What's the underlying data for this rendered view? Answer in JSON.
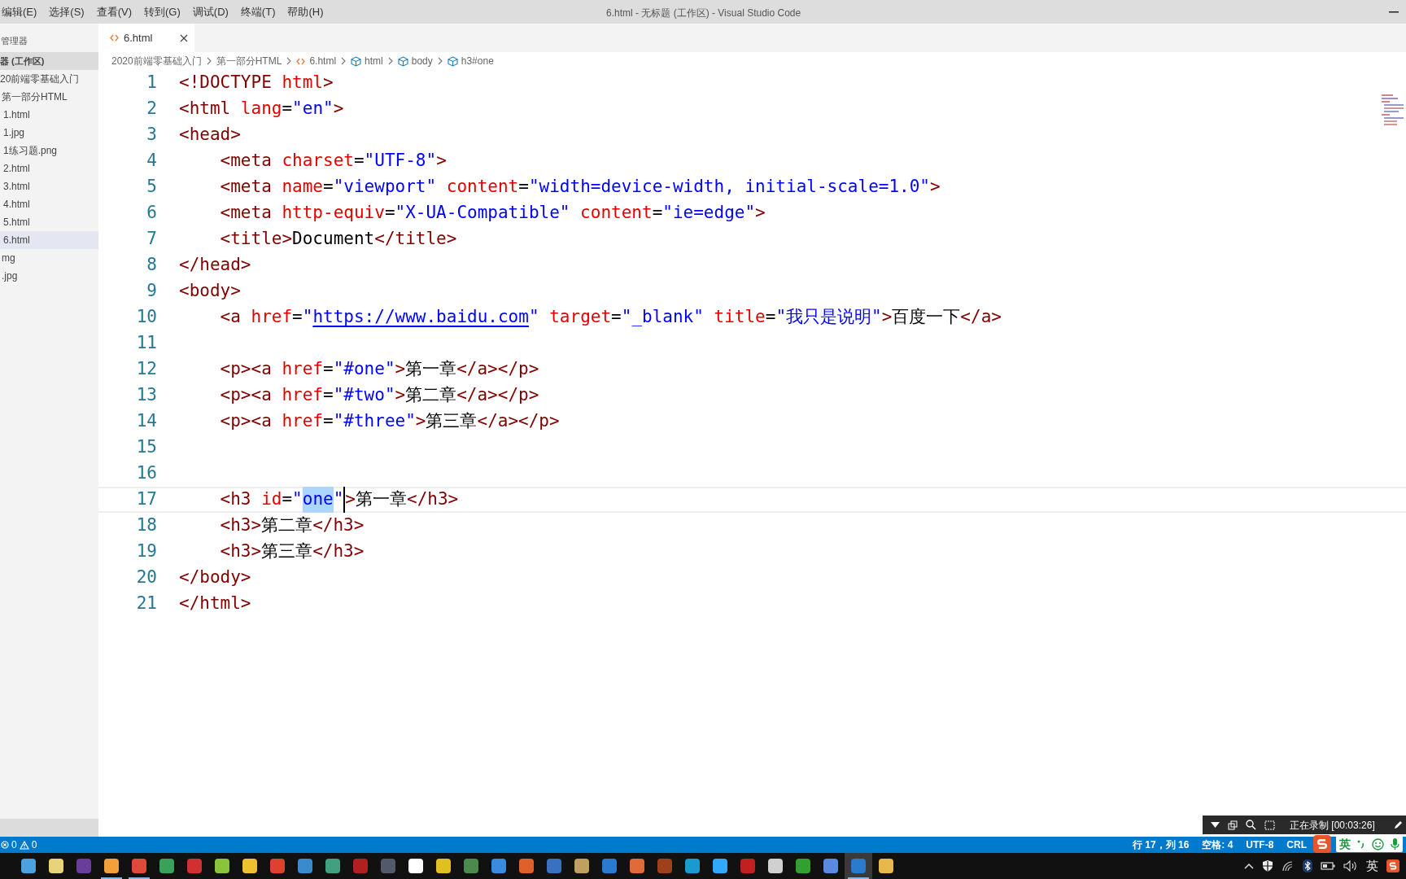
{
  "menu": [
    "编辑(E)",
    "选择(S)",
    "查看(V)",
    "转到(G)",
    "调试(D)",
    "终端(T)",
    "帮助(H)"
  ],
  "window": {
    "title": "6.html - 无标题 (工作区) - Visual Studio Code"
  },
  "sidebar": {
    "header": "管理器",
    "section": "器 (工作区)",
    "tree": [
      {
        "label": "20前端零基础入门",
        "selected": false,
        "children": [
          {
            "label": "第一部分HTML",
            "selected": false,
            "children": [
              {
                "label": "1.html",
                "selected": false
              },
              {
                "label": "1.jpg",
                "selected": false
              },
              {
                "label": "1练习题.png",
                "selected": false
              },
              {
                "label": "2.html",
                "selected": false
              },
              {
                "label": "3.html",
                "selected": false
              },
              {
                "label": "4.html",
                "selected": false
              },
              {
                "label": "5.html",
                "selected": false
              },
              {
                "label": "6.html",
                "selected": true
              }
            ]
          },
          {
            "label": "mg",
            "selected": false
          },
          {
            "label": ".jpg",
            "selected": false
          }
        ]
      }
    ]
  },
  "tabs": [
    {
      "label": "6.html",
      "selected": true
    }
  ],
  "breadcrumbs": [
    {
      "kind": "folder",
      "label": "2020前端零基础入门"
    },
    {
      "kind": "folder",
      "label": "第一部分HTML"
    },
    {
      "kind": "file",
      "label": "6.html"
    },
    {
      "kind": "element",
      "label": "html"
    },
    {
      "kind": "element",
      "label": "body"
    },
    {
      "kind": "element",
      "label": "h3#one"
    }
  ],
  "code": [
    {
      "number": "1",
      "current": false,
      "tokens": [
        {
          "kind": "tag",
          "text": "<!DOCTYPE"
        },
        {
          "kind": "attr",
          "text": " html"
        },
        {
          "kind": "tag",
          "text": ">"
        }
      ]
    },
    {
      "number": "2",
      "current": false,
      "tokens": [
        {
          "kind": "tag",
          "text": "<html"
        },
        {
          "kind": "attr",
          "text": " lang"
        },
        {
          "kind": "plain",
          "text": "="
        },
        {
          "kind": "str",
          "text": "\"en\""
        },
        {
          "kind": "tag",
          "text": ">"
        }
      ]
    },
    {
      "number": "3",
      "current": false,
      "tokens": [
        {
          "kind": "tag",
          "text": "<head>"
        }
      ]
    },
    {
      "number": "4",
      "current": false,
      "tokens": [
        {
          "kind": "tag",
          "text": "    <meta"
        },
        {
          "kind": "attr",
          "text": " charset"
        },
        {
          "kind": "plain",
          "text": "="
        },
        {
          "kind": "str",
          "text": "\"UTF-8\""
        },
        {
          "kind": "tag",
          "text": ">"
        }
      ]
    },
    {
      "number": "5",
      "current": false,
      "tokens": [
        {
          "kind": "tag",
          "text": "    <meta"
        },
        {
          "kind": "attr",
          "text": " name"
        },
        {
          "kind": "plain",
          "text": "="
        },
        {
          "kind": "str",
          "text": "\"viewport\""
        },
        {
          "kind": "attr",
          "text": " content"
        },
        {
          "kind": "plain",
          "text": "="
        },
        {
          "kind": "str",
          "text": "\"width=device-width, initial-scale=1.0\""
        },
        {
          "kind": "tag",
          "text": ">"
        }
      ]
    },
    {
      "number": "6",
      "current": false,
      "tokens": [
        {
          "kind": "tag",
          "text": "    <meta"
        },
        {
          "kind": "attr",
          "text": " http-equiv"
        },
        {
          "kind": "plain",
          "text": "="
        },
        {
          "kind": "str",
          "text": "\"X-UA-Compatible\""
        },
        {
          "kind": "attr",
          "text": " content"
        },
        {
          "kind": "plain",
          "text": "="
        },
        {
          "kind": "str",
          "text": "\"ie=edge\""
        },
        {
          "kind": "tag",
          "text": ">"
        }
      ]
    },
    {
      "number": "7",
      "current": false,
      "tokens": [
        {
          "kind": "tag",
          "text": "    <title>"
        },
        {
          "kind": "plain",
          "text": "Document"
        },
        {
          "kind": "tag",
          "text": "</title>"
        }
      ]
    },
    {
      "number": "8",
      "current": false,
      "tokens": [
        {
          "kind": "tag",
          "text": "</head>"
        }
      ]
    },
    {
      "number": "9",
      "current": false,
      "tokens": [
        {
          "kind": "tag",
          "text": "<body>"
        }
      ]
    },
    {
      "number": "10",
      "current": false,
      "tokens": [
        {
          "kind": "tag",
          "text": "    <a"
        },
        {
          "kind": "attr",
          "text": " href"
        },
        {
          "kind": "plain",
          "text": "="
        },
        {
          "kind": "str",
          "text": "\""
        },
        {
          "kind": "str",
          "text": "https://www.baidu.com",
          "link": true
        },
        {
          "kind": "str",
          "text": "\""
        },
        {
          "kind": "attr",
          "text": " target"
        },
        {
          "kind": "plain",
          "text": "="
        },
        {
          "kind": "str",
          "text": "\"_blank\""
        },
        {
          "kind": "attr",
          "text": " title"
        },
        {
          "kind": "plain",
          "text": "="
        },
        {
          "kind": "str",
          "text": "\"我只是说明\""
        },
        {
          "kind": "tag",
          "text": ">"
        },
        {
          "kind": "plain",
          "text": "百度一下"
        },
        {
          "kind": "tag",
          "text": "</a>"
        }
      ]
    },
    {
      "number": "11",
      "current": false
    },
    {
      "number": "12",
      "current": false,
      "tokens": [
        {
          "kind": "tag",
          "text": "    <p><a"
        },
        {
          "kind": "attr",
          "text": " href"
        },
        {
          "kind": "plain",
          "text": "="
        },
        {
          "kind": "str",
          "text": "\"#one\""
        },
        {
          "kind": "tag",
          "text": ">"
        },
        {
          "kind": "plain",
          "text": "第一章"
        },
        {
          "kind": "tag",
          "text": "</a></p>"
        }
      ]
    },
    {
      "number": "13",
      "current": false,
      "tokens": [
        {
          "kind": "tag",
          "text": "    <p><a"
        },
        {
          "kind": "attr",
          "text": " href"
        },
        {
          "kind": "plain",
          "text": "="
        },
        {
          "kind": "str",
          "text": "\"#two\""
        },
        {
          "kind": "tag",
          "text": ">"
        },
        {
          "kind": "plain",
          "text": "第二章"
        },
        {
          "kind": "tag",
          "text": "</a></p>"
        }
      ]
    },
    {
      "number": "14",
      "current": false,
      "tokens": [
        {
          "kind": "tag",
          "text": "    <p><a"
        },
        {
          "kind": "attr",
          "text": " href"
        },
        {
          "kind": "plain",
          "text": "="
        },
        {
          "kind": "str",
          "text": "\"#three\""
        },
        {
          "kind": "tag",
          "text": ">"
        },
        {
          "kind": "plain",
          "text": "第三章"
        },
        {
          "kind": "tag",
          "text": "</a></p>"
        }
      ]
    },
    {
      "number": "15",
      "current": false
    },
    {
      "number": "16",
      "current": false
    },
    {
      "number": "17",
      "current": true,
      "tokens": [
        {
          "kind": "tag",
          "text": "    <h3"
        },
        {
          "kind": "attr",
          "text": " id"
        },
        {
          "kind": "plain",
          "text": "="
        },
        {
          "kind": "str",
          "text": "\""
        },
        {
          "kind": "str",
          "text": "one",
          "highlight": true
        },
        {
          "kind": "str",
          "text": "\"",
          "cursor_after": true
        },
        {
          "kind": "tag",
          "text": ">"
        },
        {
          "kind": "plain",
          "text": "第一章"
        },
        {
          "kind": "tag",
          "text": "</h3>"
        }
      ]
    },
    {
      "number": "18",
      "current": false,
      "tokens": [
        {
          "kind": "tag",
          "text": "    <h3>"
        },
        {
          "kind": "plain",
          "text": "第二章"
        },
        {
          "kind": "tag",
          "text": "</h3>"
        }
      ]
    },
    {
      "number": "19",
      "current": false,
      "tokens": [
        {
          "kind": "tag",
          "text": "    <h3>"
        },
        {
          "kind": "plain",
          "text": "第三章"
        },
        {
          "kind": "tag",
          "text": "</h3>"
        }
      ]
    },
    {
      "number": "20",
      "current": false,
      "tokens": [
        {
          "kind": "tag",
          "text": "</body>"
        }
      ]
    },
    {
      "number": "21",
      "current": false,
      "tokens": [
        {
          "kind": "tag",
          "text": "</html>"
        }
      ]
    }
  ],
  "status_bar": {
    "errors": "0",
    "warnings": "0",
    "position": "行 17，列 16",
    "indent": "空格: 4",
    "encoding": "UTF-8",
    "eol": "CRL"
  },
  "recorder": {
    "label": "正在录制 [00:03:26]"
  },
  "ime": {
    "mode": "英"
  },
  "taskbar": {
    "apps": [
      {
        "running": false,
        "active": false
      },
      {
        "running": false,
        "active": false
      },
      {
        "running": false,
        "active": false
      },
      {
        "running": true,
        "active": false
      },
      {
        "running": true,
        "active": false
      },
      {
        "running": false,
        "active": false
      },
      {
        "running": false,
        "active": false
      },
      {
        "running": false,
        "active": false
      },
      {
        "running": false,
        "active": false
      },
      {
        "running": false,
        "active": false
      },
      {
        "running": false,
        "active": false
      },
      {
        "running": false,
        "active": false
      },
      {
        "running": false,
        "active": false
      },
      {
        "running": false,
        "active": false
      },
      {
        "running": false,
        "active": false
      },
      {
        "running": false,
        "active": false
      },
      {
        "running": false,
        "active": false
      },
      {
        "running": false,
        "active": false
      },
      {
        "running": false,
        "active": false
      },
      {
        "running": false,
        "active": false
      },
      {
        "running": false,
        "active": false
      },
      {
        "running": false,
        "active": false
      },
      {
        "running": false,
        "active": false
      },
      {
        "running": false,
        "active": false
      },
      {
        "running": false,
        "active": false
      },
      {
        "running": false,
        "active": false
      },
      {
        "running": false,
        "active": false
      },
      {
        "running": false,
        "active": false
      },
      {
        "running": false,
        "active": false
      },
      {
        "running": false,
        "active": false
      },
      {
        "running": true,
        "active": true
      },
      {
        "running": false,
        "active": false
      }
    ],
    "tray_ime": "英"
  }
}
